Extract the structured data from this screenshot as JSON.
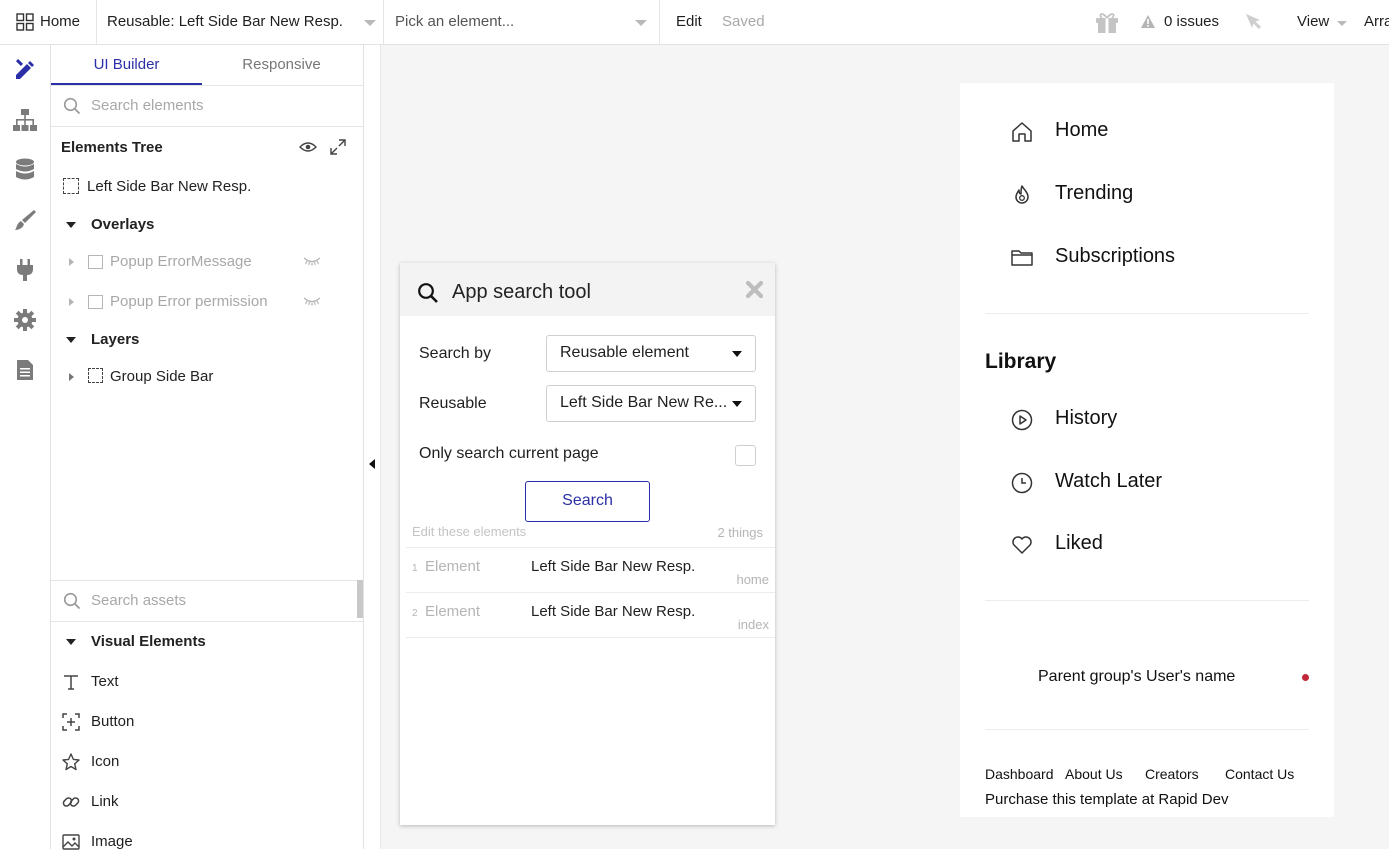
{
  "topbar": {
    "home": "Home",
    "page_selector": "Reusable: Left Side Bar New Resp.",
    "element_picker": "Pick an element...",
    "edit": "Edit",
    "saved": "Saved",
    "issues": "0 issues",
    "view": "View",
    "arrange": "Arra"
  },
  "panel": {
    "tabs": [
      "UI Builder",
      "Responsive"
    ],
    "search_elements_placeholder": "Search elements",
    "tree_title": "Elements Tree",
    "tree": {
      "root": "Left Side Bar New Resp.",
      "overlays": "Overlays",
      "popup1": "Popup ErrorMessage",
      "popup2": "Popup Error permission",
      "layers": "Layers",
      "group": "Group Side Bar"
    },
    "search_assets_placeholder": "Search assets",
    "visual_elements": "Visual Elements",
    "assets": [
      "Text",
      "Button",
      "Icon",
      "Link",
      "Image"
    ]
  },
  "modal": {
    "title": "App search tool",
    "search_by_label": "Search by",
    "search_by_value": "Reusable element",
    "reusable_label": "Reusable",
    "reusable_value": "Left Side Bar New Re...",
    "only_current_label": "Only search current page",
    "only_current_checked": false,
    "search_button": "Search",
    "edit_hint": "Edit these elements",
    "count": "2 things",
    "results": [
      {
        "index": "1",
        "type": "Element",
        "name": "Left Side Bar New Resp.",
        "page": "home"
      },
      {
        "index": "2",
        "type": "Element",
        "name": "Left Side Bar New Resp.",
        "page": "index"
      }
    ]
  },
  "preview": {
    "nav": [
      "Home",
      "Trending",
      "Subscriptions"
    ],
    "library_title": "Library",
    "library": [
      "History",
      "Watch Later",
      "Liked"
    ],
    "user_name": "Parent group's User's name",
    "status_color": "#c0283a",
    "footer_links": [
      "Dashboard",
      "About Us",
      "Creators",
      "Contact Us"
    ],
    "purchase": "Purchase this template at Rapid Dev"
  },
  "colors": {
    "accent": "#2a2fa8",
    "muted": "#a8a8a8"
  }
}
